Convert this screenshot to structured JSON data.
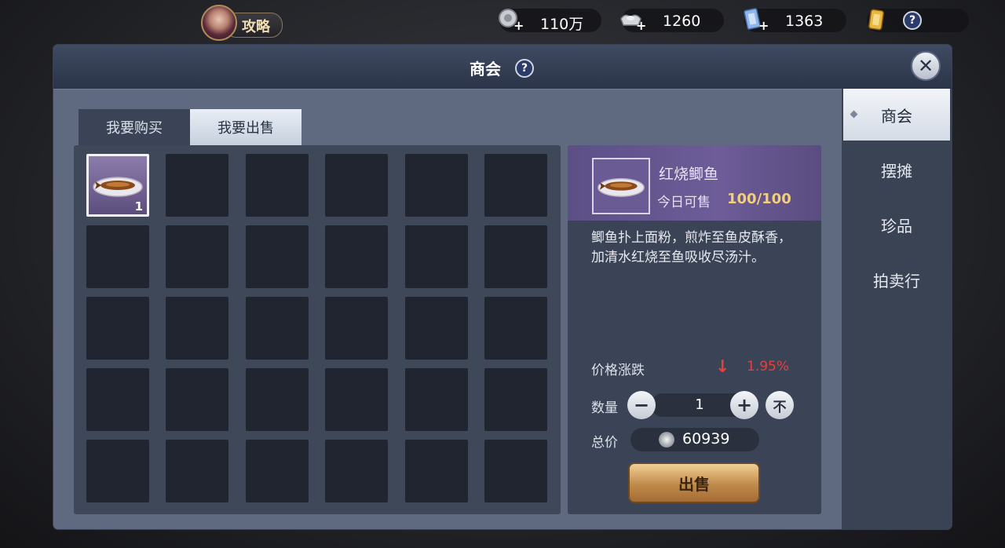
{
  "topbar": {
    "guide_label": "攻略",
    "resources": [
      {
        "icon": "silver-coin-icon",
        "value": "110万"
      },
      {
        "icon": "silver-ingot-icon",
        "value": "1260"
      },
      {
        "icon": "blue-ticket-icon",
        "value": "1363"
      },
      {
        "icon": "gold-token-icon",
        "value": ""
      }
    ],
    "help_label": "?"
  },
  "panel": {
    "title": "商会",
    "help_label": "?",
    "close_label": "✕"
  },
  "tabs": [
    {
      "label": "我要购买",
      "active": false
    },
    {
      "label": "我要出售",
      "active": true
    }
  ],
  "inventory": {
    "columns": 6,
    "rows": 5,
    "items": [
      {
        "name": "红烧鲫鱼",
        "icon": "braised-fish-icon",
        "count": "1",
        "selected": true
      }
    ]
  },
  "detail": {
    "item_name": "红烧鲫鱼",
    "sell_limit_label": "今日可售",
    "sell_limit_value": "100/100",
    "description": "鲫鱼扑上面粉，煎炸至鱼皮酥香，加清水红烧至鱼吸收尽汤汁。",
    "price_trend_label": "价格涨跌",
    "price_trend_direction": "down",
    "price_trend_arrow": "↓",
    "price_trend_value": "1.95%",
    "quantity_label": "数量",
    "quantity_value": "1",
    "minus_label": "−",
    "plus_label": "+",
    "max_label": "不",
    "total_label": "总价",
    "total_value": "60939",
    "sell_button_label": "出售",
    "colors": {
      "trend_down": "#e2413c",
      "limit_value": "#f2cf78"
    }
  },
  "side_nav": [
    {
      "label": "商会",
      "active": true
    },
    {
      "label": "摆摊",
      "active": false
    },
    {
      "label": "珍品",
      "active": false
    },
    {
      "label": "拍卖行",
      "active": false
    }
  ]
}
